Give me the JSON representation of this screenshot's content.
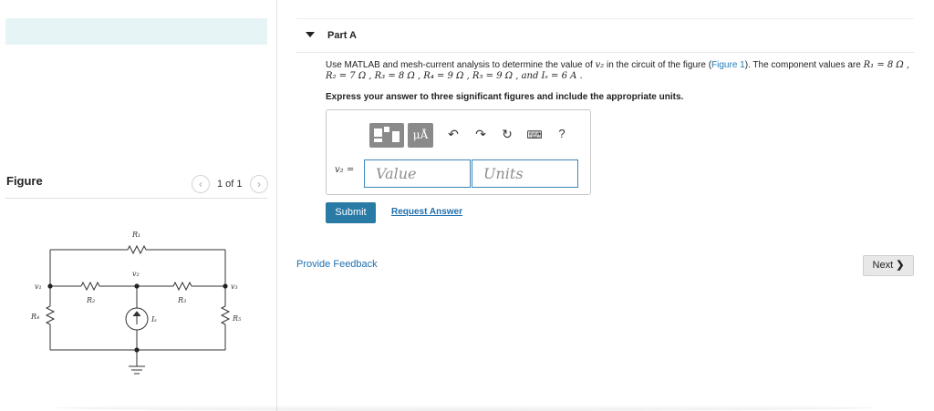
{
  "figure_panel": {
    "title": "Figure",
    "pager": {
      "prev_icon": "chevron-left-icon",
      "count": "1 of 1",
      "next_icon": "chevron-right-icon"
    },
    "circuit_labels": {
      "R1": "R₁",
      "R2": "R₂",
      "R3": "R₃",
      "R4": "R₄",
      "R5": "R₅",
      "v1": "v₁",
      "v2": "v₂",
      "v3": "v₃",
      "Is": "Iₛ"
    }
  },
  "part": {
    "title": "Part A",
    "question_lead": "Use MATLAB and mesh-current analysis to determine the value of ",
    "question_var": "v₂",
    "question_mid": " in the circuit of the figure (",
    "figure_link": "Figure 1",
    "question_post": "). The component values are ",
    "question_values": "R₁ = 8 Ω , R₂ = 7 Ω , R₃ = 8 Ω , R₄ = 9 Ω , R₅ = 9 Ω , and Iₛ = 6 A .",
    "instruction": "Express your answer to three significant figures and include the appropriate units."
  },
  "answer": {
    "toolbar": {
      "matrix_icon": "templates-icon",
      "units_label": "μÅ",
      "undo_icon": "undo-icon",
      "redo_icon": "redo-icon",
      "reset_icon": "reset-icon",
      "keyboard_icon": "keyboard-icon",
      "help_label": "?"
    },
    "equation_label": "v₂ =",
    "value_placeholder": "Value",
    "units_placeholder": "Units"
  },
  "actions": {
    "submit": "Submit",
    "request_answer": "Request Answer",
    "feedback": "Provide Feedback",
    "next": "Next"
  },
  "colors": {
    "accent": "#2a7aa6",
    "link": "#1f6fae",
    "band": "#e6f4f6"
  }
}
